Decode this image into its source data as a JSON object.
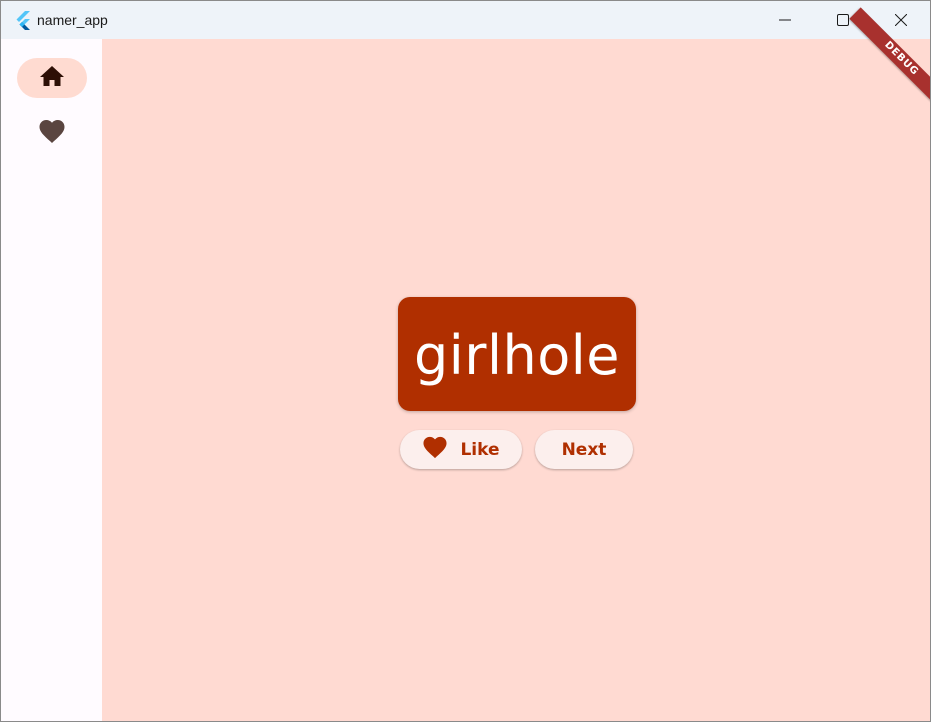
{
  "window": {
    "title": "namer_app",
    "logo_icon": "flutter-logo-icon",
    "controls": [
      "minimize-icon",
      "maximize-icon",
      "close-icon"
    ]
  },
  "navigation_rail": {
    "destinations": [
      {
        "icon": "home-icon",
        "selected": true
      },
      {
        "icon": "favorite-icon",
        "selected": false
      }
    ]
  },
  "generator": {
    "word_pair": "girlhole",
    "like_label": "Like",
    "next_label": "Next"
  },
  "debug_banner": "DEBUG",
  "colors": {
    "primary": "#b02f00",
    "background": "#ffdad2",
    "rail_background": "#fffbff",
    "selected_indicator": "#ffdbd1",
    "button_surface": "#fcefed",
    "banner": "#a8312e"
  }
}
